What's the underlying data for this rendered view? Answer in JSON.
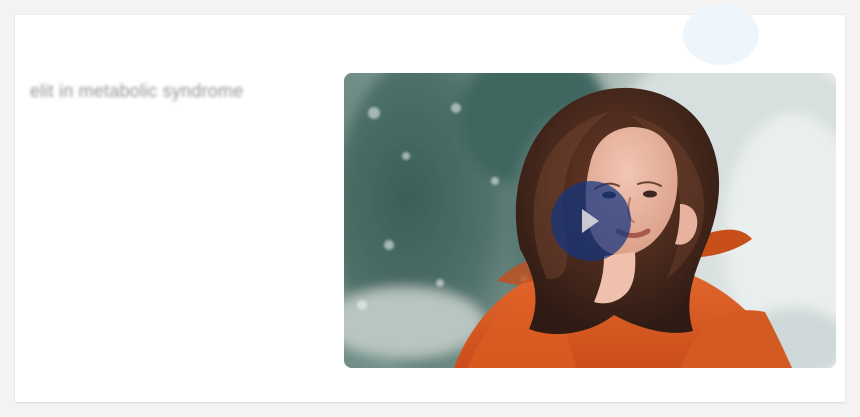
{
  "page": {
    "heading": "elit in metabolic syndrome"
  },
  "video": {
    "thumbnail_subject": "woman-in-orange-coat",
    "play_button_label": "Play video"
  },
  "icons": {
    "play": "play-icon"
  },
  "colors": {
    "card_background": "#ffffff",
    "page_background": "#f3f3f4",
    "accent": "#123580",
    "coat": "#d9571f"
  }
}
